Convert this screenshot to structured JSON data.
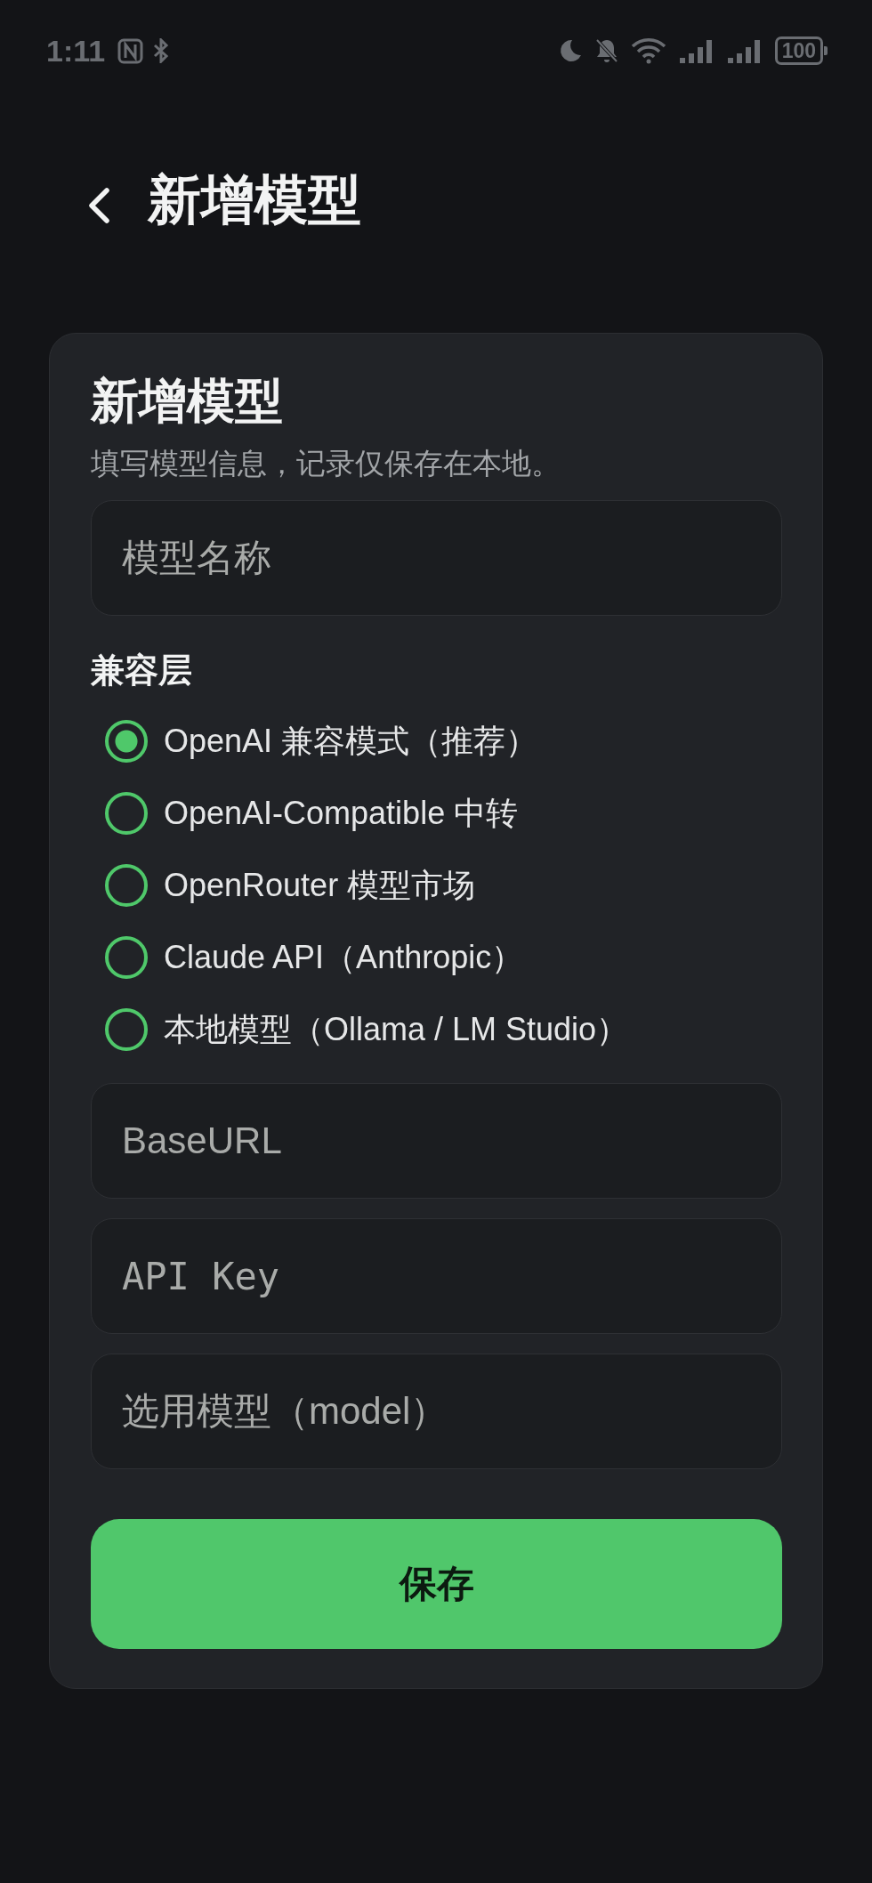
{
  "status_bar": {
    "time": "1:11",
    "battery": "100"
  },
  "header": {
    "title": "新增模型"
  },
  "form": {
    "title": "新增模型",
    "subtitle": "填写模型信息，记录仅保存在本地。",
    "name_field": {
      "placeholder": "模型名称"
    },
    "compat_layer": {
      "label": "兼容层",
      "options": [
        {
          "label": "OpenAI 兼容模式（推荐）",
          "selected": true
        },
        {
          "label": "OpenAI-Compatible 中转",
          "selected": false
        },
        {
          "label": "OpenRouter 模型市场",
          "selected": false
        },
        {
          "label": "Claude API（Anthropic）",
          "selected": false
        },
        {
          "label": "本地模型（Ollama / LM Studio）",
          "selected": false
        }
      ]
    },
    "fields": [
      {
        "placeholder": "BaseURL",
        "kind": "text"
      },
      {
        "placeholder": "API Key",
        "kind": "key"
      },
      {
        "placeholder": "选用模型（model）",
        "kind": "text"
      }
    ],
    "save_button": {
      "label": "保存"
    }
  }
}
